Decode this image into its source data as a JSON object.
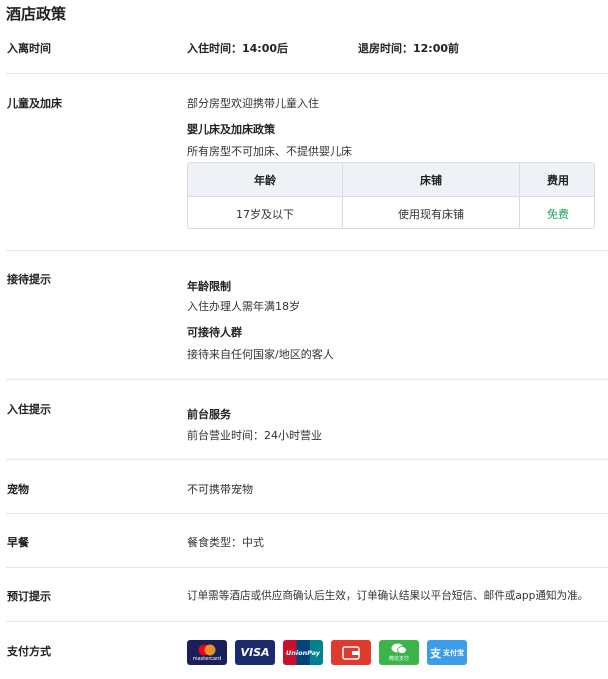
{
  "title": "酒店政策",
  "checkin": {
    "label": "入离时间",
    "checkin_label": "入住时间：",
    "checkin_time": "14:00后",
    "checkout_label": "退房时间：",
    "checkout_time": "12:00前"
  },
  "children": {
    "label": "儿童及加床",
    "intro": "部分房型欢迎携带儿童入住",
    "policy_title": "婴儿床及加床政策",
    "policy_text": "所有房型不可加床、不提供婴儿床",
    "table": {
      "headers": [
        "年龄",
        "床铺",
        "费用"
      ],
      "rows": [
        [
          "17岁及以下",
          "使用现有床铺",
          "免费"
        ]
      ]
    }
  },
  "reception": {
    "label": "接待提示",
    "age_title": "年龄限制",
    "age_text": "入住办理人需年满18岁",
    "guests_title": "可接待人群",
    "guests_text": "接待来自任何国家/地区的客人"
  },
  "checkin_tips": {
    "label": "入住提示",
    "front_title": "前台服务",
    "front_text": "前台营业时间：24小时营业"
  },
  "pets": {
    "label": "宠物",
    "text": "不可携带宠物"
  },
  "breakfast": {
    "label": "早餐",
    "text": "餐食类型：中式"
  },
  "booking": {
    "label": "预订提示",
    "text": "订单需等酒店或供应商确认后生效，订单确认结果以平台短信、邮件或app通知为准。"
  },
  "payment": {
    "label": "支付方式",
    "methods": [
      {
        "name": "mastercard",
        "text": "mastercard",
        "color": "#1a1f5c"
      },
      {
        "name": "visa",
        "text": "VISA",
        "color": "#1a2b6d"
      },
      {
        "name": "unionpay",
        "text": "UnionPay",
        "color": "#c8102e"
      },
      {
        "name": "wallet",
        "text": "",
        "color": "#e03a2f"
      },
      {
        "name": "wechat",
        "text": "微信支付",
        "color": "#3bb54a"
      },
      {
        "name": "alipay",
        "text": "支付宝",
        "color": "#3c9ee8"
      }
    ]
  }
}
